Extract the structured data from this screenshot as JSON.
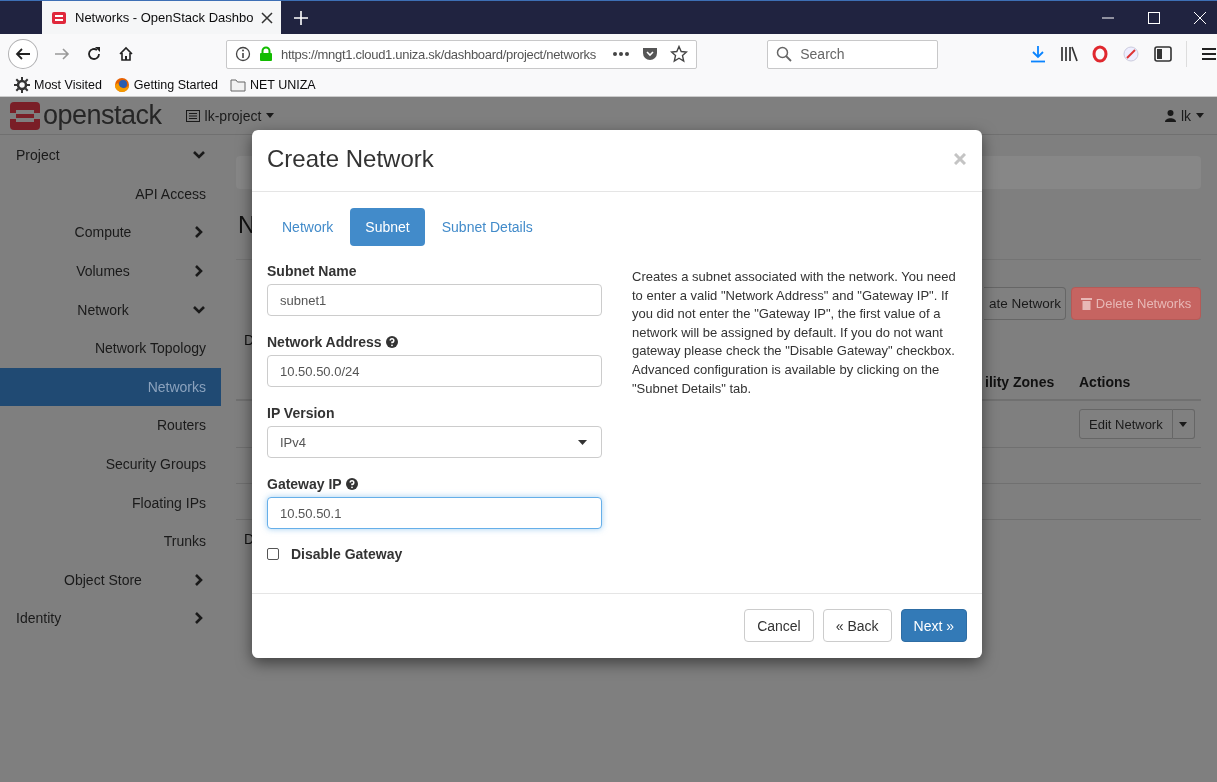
{
  "browser": {
    "tabs": [
      {
        "title": "Networks - OpenStack Dashbo",
        "selected": true
      }
    ],
    "url": "https://mngt1.cloud1.uniza.sk/dashboard/project/networks",
    "search_placeholder": "Search",
    "bookmarks": [
      {
        "label": "Most Visited",
        "kind": "gear"
      },
      {
        "label": "Getting Started",
        "kind": "firefox"
      },
      {
        "label": "NET UNIZA",
        "kind": "folder"
      }
    ]
  },
  "header": {
    "logo": "openstack",
    "project": "lk-project",
    "user": "lk"
  },
  "sidebar": {
    "items": [
      {
        "label": "Project",
        "expanded": true,
        "children": [
          {
            "label": "API Access",
            "selected": false
          },
          {
            "label": "Compute",
            "expanded": false
          },
          {
            "label": "Volumes",
            "expanded": false
          },
          {
            "label": "Network",
            "expanded": true,
            "children": [
              {
                "label": "Network Topology",
                "selected": false
              },
              {
                "label": "Networks",
                "selected": true
              },
              {
                "label": "Routers",
                "selected": false
              },
              {
                "label": "Security Groups",
                "selected": false
              },
              {
                "label": "Floating IPs",
                "selected": false
              },
              {
                "label": "Trunks",
                "selected": false
              }
            ]
          },
          {
            "label": "Object Store",
            "expanded": false
          }
        ]
      },
      {
        "label": "Identity",
        "expanded": false
      }
    ]
  },
  "page": {
    "heading": "N",
    "summary_top": "D",
    "summary_bottom": "D",
    "toolbar_buttons": [
      {
        "label": "ate Network",
        "kind": "default"
      },
      {
        "label": "Delete Networks",
        "kind": "danger"
      }
    ],
    "columns": [
      "ility Zones",
      "Actions"
    ],
    "row_action": "Edit Network"
  },
  "modal": {
    "title": "Create Network",
    "tabs": [
      {
        "label": "Network",
        "selected": false
      },
      {
        "label": "Subnet",
        "selected": true
      },
      {
        "label": "Subnet Details",
        "selected": false
      }
    ],
    "fields": [
      {
        "kind": "text",
        "label": "Subnet Name",
        "value": "subnet1",
        "focused": false
      },
      {
        "kind": "text",
        "label": "Network Address",
        "help": true,
        "value": "10.50.50.0/24",
        "focused": false
      },
      {
        "kind": "select",
        "label": "IP Version",
        "value": "IPv4",
        "focused": false
      },
      {
        "kind": "text",
        "label": "Gateway IP",
        "help": true,
        "value": "10.50.50.1",
        "focused": true
      },
      {
        "kind": "checkbox",
        "label": "Disable Gateway",
        "checked": false
      }
    ],
    "description": "Creates a subnet associated with the network. You need to enter a valid \"Network Address\" and \"Gateway IP\". If you did not enter the \"Gateway IP\", the first value of a network will be assigned by default. If you do not want gateway please check the \"Disable Gateway\" checkbox. Advanced configuration is available by clicking on the \"Subnet Details\" tab.",
    "buttons": [
      {
        "label": "Cancel",
        "kind": "default"
      },
      {
        "label": "« Back",
        "kind": "default"
      },
      {
        "label": "Next »",
        "kind": "primary"
      }
    ]
  }
}
